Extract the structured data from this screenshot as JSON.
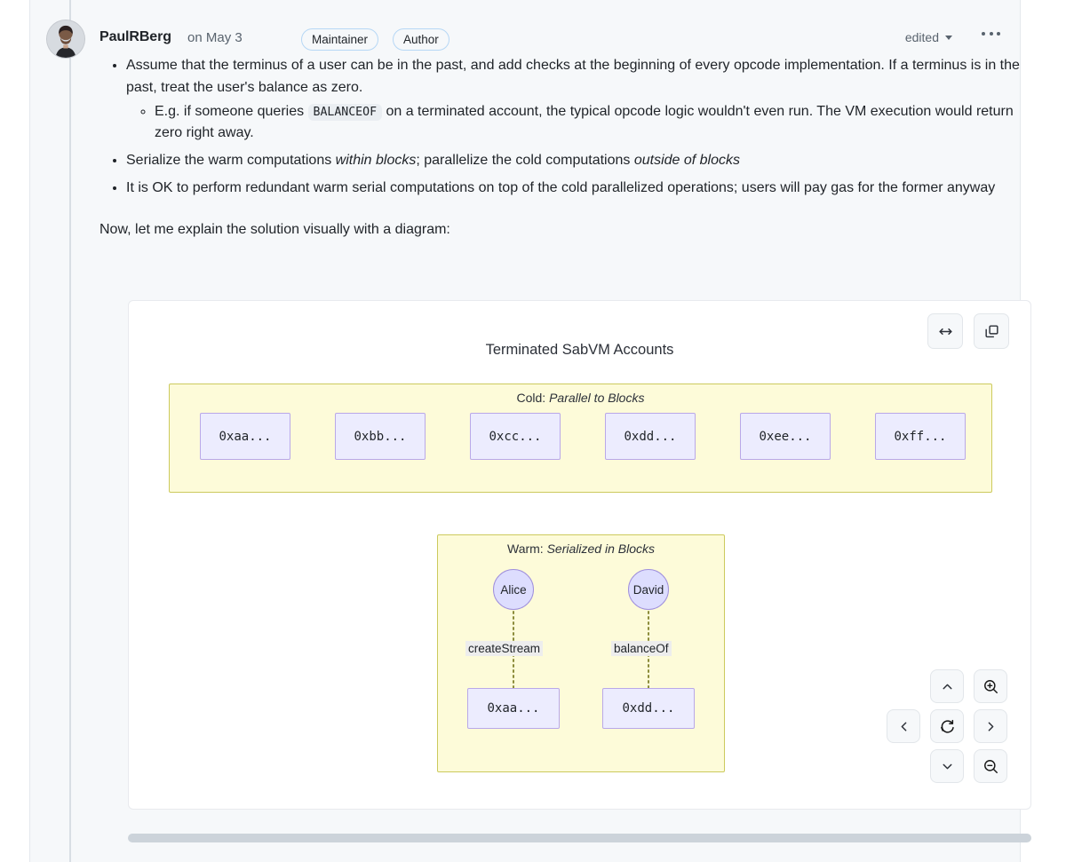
{
  "comment": {
    "author": "PaulRBerg",
    "timestamp": "on May 3",
    "badges": [
      "Maintainer",
      "Author"
    ],
    "edited_label": "edited",
    "more_menu_label": "…",
    "avatar_alt": "PaulRBerg avatar"
  },
  "body": {
    "bullets": [
      {
        "text_before": "Assume that the terminus of a user can be in the past, and add checks at the beginning of every opcode implementation. If a terminus is in the past, treat the user's balance as zero.",
        "sub": [
          {
            "pre": "E.g. if someone queries ",
            "code": "BALANCEOF",
            "post": " on a terminated account, the typical opcode logic wouldn't even run. The VM execution would return zero right away."
          }
        ]
      },
      {
        "parts": [
          "Serialize the warm computations ",
          "within blocks",
          "; parallelize the cold computations ",
          "outside of blocks"
        ]
      },
      {
        "text_before": "It is OK to perform redundant warm serial computations on top of the cold parallelized operations; users will pay gas for the former anyway"
      }
    ],
    "paragraph": "Now, let me explain the solution visually with a diagram:"
  },
  "diagram": {
    "title": "Terminated SabVM Accounts",
    "toolbar": [
      {
        "name": "fit-width-button",
        "icon": "arrows-left-right-icon"
      },
      {
        "name": "copy-button",
        "icon": "copy-icon"
      }
    ],
    "cold": {
      "label_prefix": "Cold: ",
      "label_italic": "Parallel to Blocks",
      "nodes": [
        "0xaa...",
        "0xbb...",
        "0xcc...",
        "0xdd...",
        "0xee...",
        "0xff..."
      ]
    },
    "warm": {
      "label_prefix": "Warm: ",
      "label_italic": "Serialized in Blocks",
      "actors": [
        "Alice",
        "David"
      ],
      "edge_labels": [
        "createStream",
        "balanceOf"
      ],
      "targets": [
        "0xaa...",
        "0xdd..."
      ]
    },
    "controls": [
      {
        "name": "pan-up-button",
        "icon": "chevron-up-icon"
      },
      {
        "name": "zoom-in-button",
        "icon": "magnifier-plus-icon"
      },
      {
        "name": "pan-left-button",
        "icon": "chevron-left-icon"
      },
      {
        "name": "reset-view-button",
        "icon": "refresh-icon"
      },
      {
        "name": "pan-right-button",
        "icon": "chevron-right-icon"
      },
      {
        "name": "pan-down-button",
        "icon": "chevron-down-icon"
      },
      {
        "name": "zoom-out-button",
        "icon": "magnifier-minus-icon"
      }
    ]
  },
  "colors": {
    "panel_bg": "#f6f8fa",
    "subgraph_fill": "#fdfbd9",
    "subgraph_border": "#ccca5d",
    "node_fill": "#ececfe",
    "node_border": "#b9a8e8",
    "circle_fill": "#ddddfe",
    "circle_border": "#9f8fdc",
    "text": "#1f2328",
    "muted": "#59636e",
    "badge_border": "#b6d7f5"
  }
}
